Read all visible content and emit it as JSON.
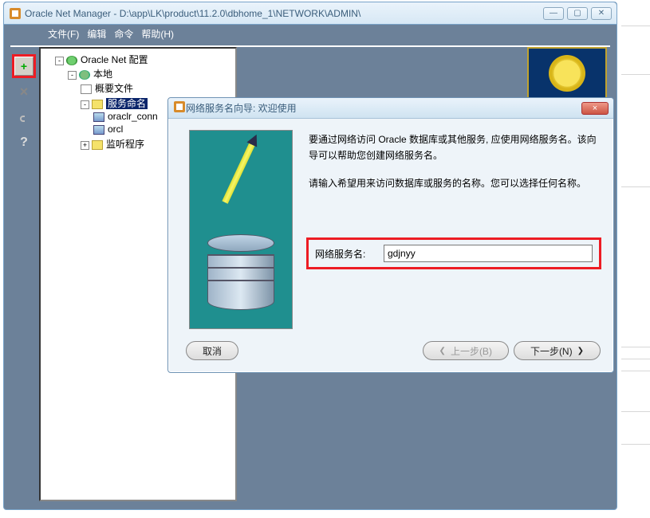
{
  "window": {
    "title": "Oracle Net Manager - D:\\app\\LK\\product\\11.2.0\\dbhome_1\\NETWORK\\ADMIN\\"
  },
  "menubar": {
    "file": "文件(F)",
    "edit": "编辑",
    "command": "命令",
    "help": "帮助(H)"
  },
  "toolbar": {
    "add": "+",
    "delete": "×",
    "link": "🔗",
    "help": "?"
  },
  "tree": {
    "root": "Oracle Net 配置",
    "local": "本地",
    "profile": "概要文件",
    "service_naming": "服务命名",
    "svc1": "oraclr_conn",
    "svc2": "orcl",
    "listeners": "监听程序"
  },
  "dialog": {
    "title": "网络服务名向导: 欢迎使用",
    "para1": "要通过网络访问 Oracle 数据库或其他服务, 应使用网络服务名。该向导可以帮助您创建网络服务名。",
    "para2": "请输入希望用来访问数据库或服务的名称。您可以选择任何名称。",
    "field_label": "网络服务名:",
    "field_value": "gdjnyy",
    "cancel": "取消",
    "back": "上一步(B)",
    "next": "下一步(N)",
    "close": "×"
  }
}
